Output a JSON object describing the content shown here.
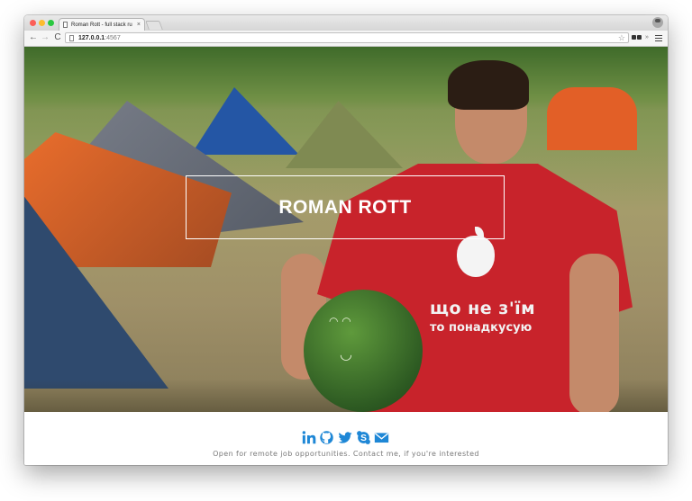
{
  "browser": {
    "tab_title": "Roman Rott - full stack ru",
    "tab_close": "×",
    "url_host": "127.0.0.1",
    "url_port": ":4567",
    "nav": {
      "back": "←",
      "forward": "→",
      "reload": "C"
    },
    "star": "☆",
    "overflow": "»"
  },
  "hero": {
    "title": "ROMAN ROTT",
    "shirt_line1": "що не з'їм",
    "shirt_line2": "то понадкусую"
  },
  "footer": {
    "social_icons": [
      "linkedin-icon",
      "github-icon",
      "twitter-icon",
      "skype-icon",
      "email-icon"
    ],
    "accent_color": "#1e87d6",
    "note": "Open for remote job opportunities. Contact me, if you're interested"
  }
}
